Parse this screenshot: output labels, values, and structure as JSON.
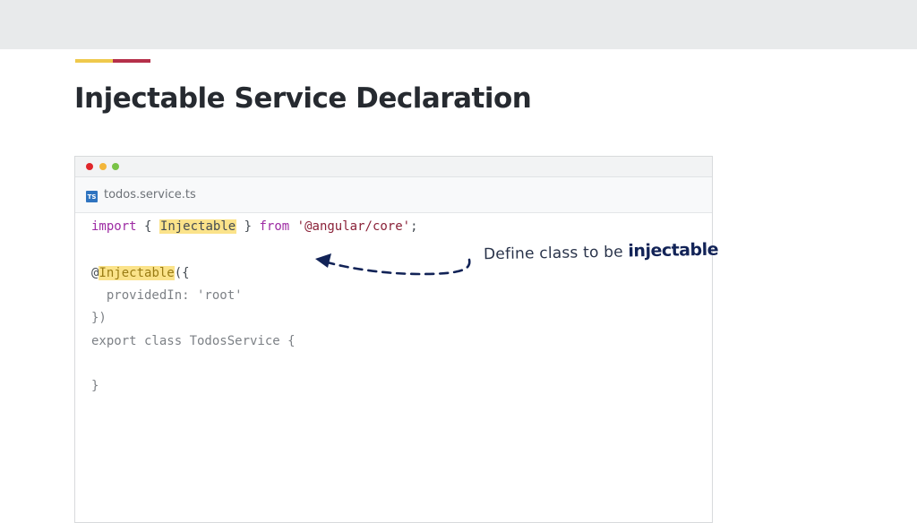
{
  "slide": {
    "title": "Injectable Service Declaration",
    "accent_colors": [
      "#efc94c",
      "#b5304a"
    ]
  },
  "editor": {
    "window_dots": [
      "#e0262a",
      "#f3b63a",
      "#79c346"
    ],
    "tab": {
      "icon": "TS",
      "filename": "todos.service.ts"
    },
    "code": {
      "line1": {
        "import": "import",
        "brace_open": "{",
        "symbol": "Injectable",
        "brace_close": "}",
        "from": "from",
        "module": "'@angular/core'",
        "semi": ";"
      },
      "line3": {
        "at": "@",
        "decorator": "Injectable",
        "rest": "({"
      },
      "line4": "  providedIn: 'root'",
      "line5": "})",
      "line6": "export class TodosService {",
      "line8": "}"
    }
  },
  "annotation": {
    "text": "Define class to be",
    "emphasis": "injectable",
    "color": "#122357"
  }
}
